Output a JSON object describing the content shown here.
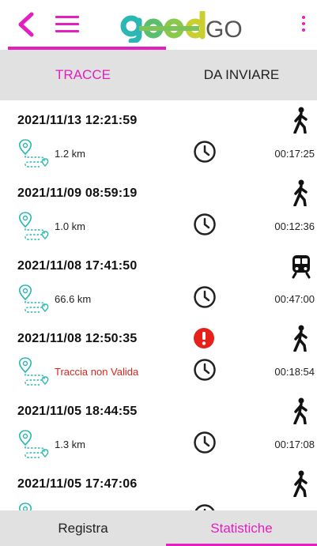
{
  "app": {
    "logo_text": "GO"
  },
  "colors": {
    "accent": "#e31fbf",
    "route": "#2bb7b3",
    "error": "#d9261c"
  },
  "tabs": [
    {
      "label": "TRACCE",
      "active": true
    },
    {
      "label": "DA INVIARE",
      "active": false
    }
  ],
  "tracks": [
    {
      "datetime": "2021/11/13 12:21:59",
      "distance": "1.2 km",
      "duration": "00:17:25",
      "mode": "walk-icon",
      "valid": true
    },
    {
      "datetime": "2021/11/09 08:59:19",
      "distance": "1.0 km",
      "duration": "00:12:36",
      "mode": "walk-icon",
      "valid": true
    },
    {
      "datetime": "2021/11/08 17:41:50",
      "distance": "66.6 km",
      "duration": "00:47:00",
      "mode": "train-icon",
      "valid": true
    },
    {
      "datetime": "2021/11/08 12:50:35",
      "distance": "Traccia non Valida",
      "duration": "00:18:54",
      "mode": "walk-icon",
      "valid": false
    },
    {
      "datetime": "2021/11/05 18:44:55",
      "distance": "1.3 km",
      "duration": "00:17:08",
      "mode": "walk-icon",
      "valid": true
    },
    {
      "datetime": "2021/11/05 17:47:06",
      "distance": "",
      "duration": "",
      "mode": "walk-icon",
      "valid": true
    }
  ],
  "bottom_tabs": [
    {
      "label": "Registra",
      "active": false
    },
    {
      "label": "Statistiche",
      "active": true
    }
  ]
}
